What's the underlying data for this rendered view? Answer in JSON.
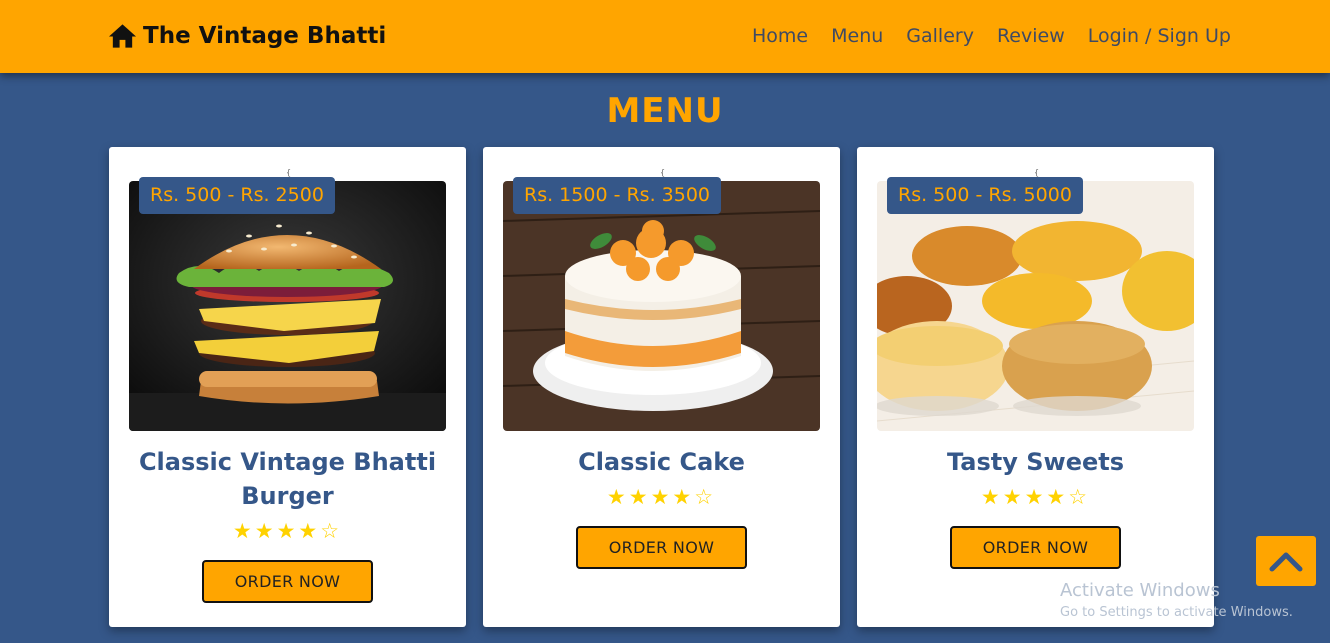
{
  "header": {
    "logo_text": "The Vintage Bhatti",
    "nav": [
      "Home",
      "Menu",
      "Gallery",
      "Review",
      "Login / Sign Up"
    ]
  },
  "menu": {
    "heading": "MENU",
    "items": [
      {
        "price": "Rs. 500 - Rs. 2500",
        "title": "Classic Vintage Bhatti Burger",
        "rating": 4,
        "rating_display": "★★★★☆",
        "button": "ORDER NOW",
        "image": "burger"
      },
      {
        "price": "Rs. 1500 - Rs. 3500",
        "title": "Classic Cake",
        "rating": 4,
        "rating_display": "★★★★☆",
        "button": "ORDER NOW",
        "image": "cake"
      },
      {
        "price": "Rs. 500 - Rs. 5000",
        "title": "Tasty Sweets",
        "rating": 4,
        "rating_display": "★★★★☆",
        "button": "ORDER NOW",
        "image": "sweets"
      }
    ]
  },
  "scroll_top_icon": "chevron-up-icon",
  "watermark": {
    "line1": "Activate Windows",
    "line2": "Go to Settings to activate Windows."
  },
  "colors": {
    "accent": "#ffa500",
    "background": "#355789",
    "title": "#355789",
    "star": "#ffd200"
  }
}
